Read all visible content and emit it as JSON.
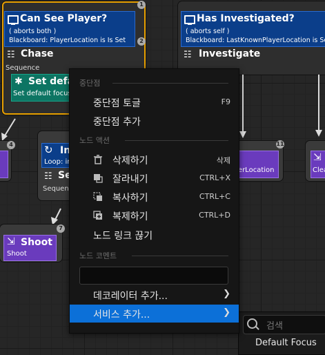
{
  "nodes": {
    "can_see_player": {
      "title": "Can See Player?",
      "aborts": "( aborts both )",
      "blackboard": "Blackboard: PlayerLocation is Is Set",
      "badge": "2"
    },
    "has_investigated": {
      "title": "Has Investigated?",
      "aborts": "( aborts self )",
      "blackboard": "Blackboard: LastKnownPlayerLocation is Set"
    },
    "chase": {
      "title": "Chase",
      "type": "Sequence",
      "badge_top": "1"
    },
    "investigate": {
      "title": "Investigate"
    },
    "set_default": {
      "title": "Set defa",
      "desc": "Set default focus"
    },
    "loop_node": {
      "title": "In",
      "desc": "Loop: in",
      "badge": "4"
    },
    "sequence_node": {
      "title": "Se",
      "type": "Sequence"
    },
    "shoot": {
      "title": "Shoot",
      "desc": "Shoot",
      "badge": "7"
    },
    "player_location_task": {
      "desc": "yerLocation",
      "badge": "11"
    },
    "clear_task": {
      "desc": "Clea"
    }
  },
  "context_menu": {
    "section_breakpoints": "중단점",
    "toggle_breakpoint": "중단점 토글",
    "toggle_breakpoint_key": "F9",
    "add_breakpoint": "중단점 추가",
    "section_node_actions": "노드 액션",
    "delete": "삭제하기",
    "delete_key": "삭제",
    "cut": "잘라내기",
    "cut_key": "CTRL+X",
    "copy": "복사하기",
    "copy_key": "CTRL+C",
    "duplicate": "복제하기",
    "duplicate_key": "CTRL+D",
    "break_links": "노드 링크 끊기",
    "section_node_comment": "노드 코멘트",
    "comment_value": "",
    "add_decorator": "데코레이터 추가...",
    "add_service": "서비스 추가..."
  },
  "search_popup": {
    "placeholder": "검색",
    "first_item": "Default Focus"
  },
  "colors": {
    "decorator": "#0b3e8a",
    "task": "#6a3bbd",
    "service": "#0d7563",
    "highlight": "#0c70d8",
    "selection": "#e8a000"
  }
}
